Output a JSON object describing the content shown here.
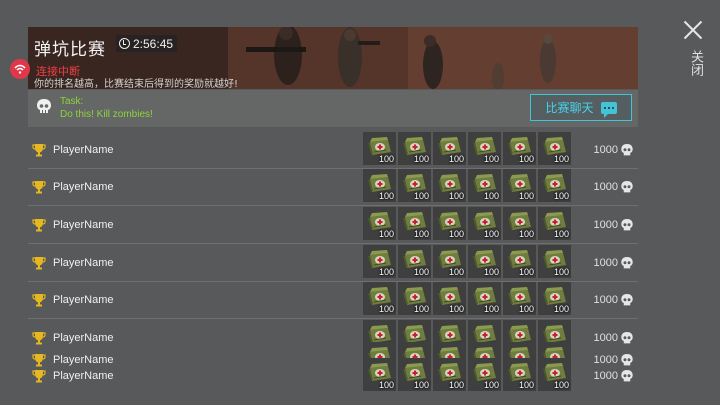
{
  "header": {
    "title": "弹坑比赛",
    "timer": "2:56:45",
    "connection_status": "连接中断",
    "rank_message": "你的排名越高，比赛结束后得到的奖励就越好!"
  },
  "task": {
    "label": "Task:",
    "description": "Do this! Kill zombies!",
    "chat_button_label": "比赛聊天"
  },
  "close_label": "关闭",
  "reward_quantity": "100",
  "players": [
    {
      "name": "PlayerName",
      "score": "1000"
    },
    {
      "name": "PlayerName",
      "score": "1000"
    },
    {
      "name": "PlayerName",
      "score": "1000"
    },
    {
      "name": "PlayerName",
      "score": "1000"
    },
    {
      "name": "PlayerName",
      "score": "1000"
    },
    {
      "name": "PlayerName",
      "score": "1000"
    },
    {
      "name": "PlayerName",
      "score": "1000"
    },
    {
      "name": "PlayerName",
      "score": "1000"
    }
  ],
  "colors": {
    "accent": "#45c3d6",
    "task_text": "#8cd43a",
    "alert": "#ef3e44",
    "trophy": "#e6b820"
  },
  "icons": [
    "clock-icon",
    "wifi-alert-icon",
    "skull-icon",
    "chat-icon",
    "close-icon",
    "trophy-icon",
    "medkit-bag-icon"
  ]
}
